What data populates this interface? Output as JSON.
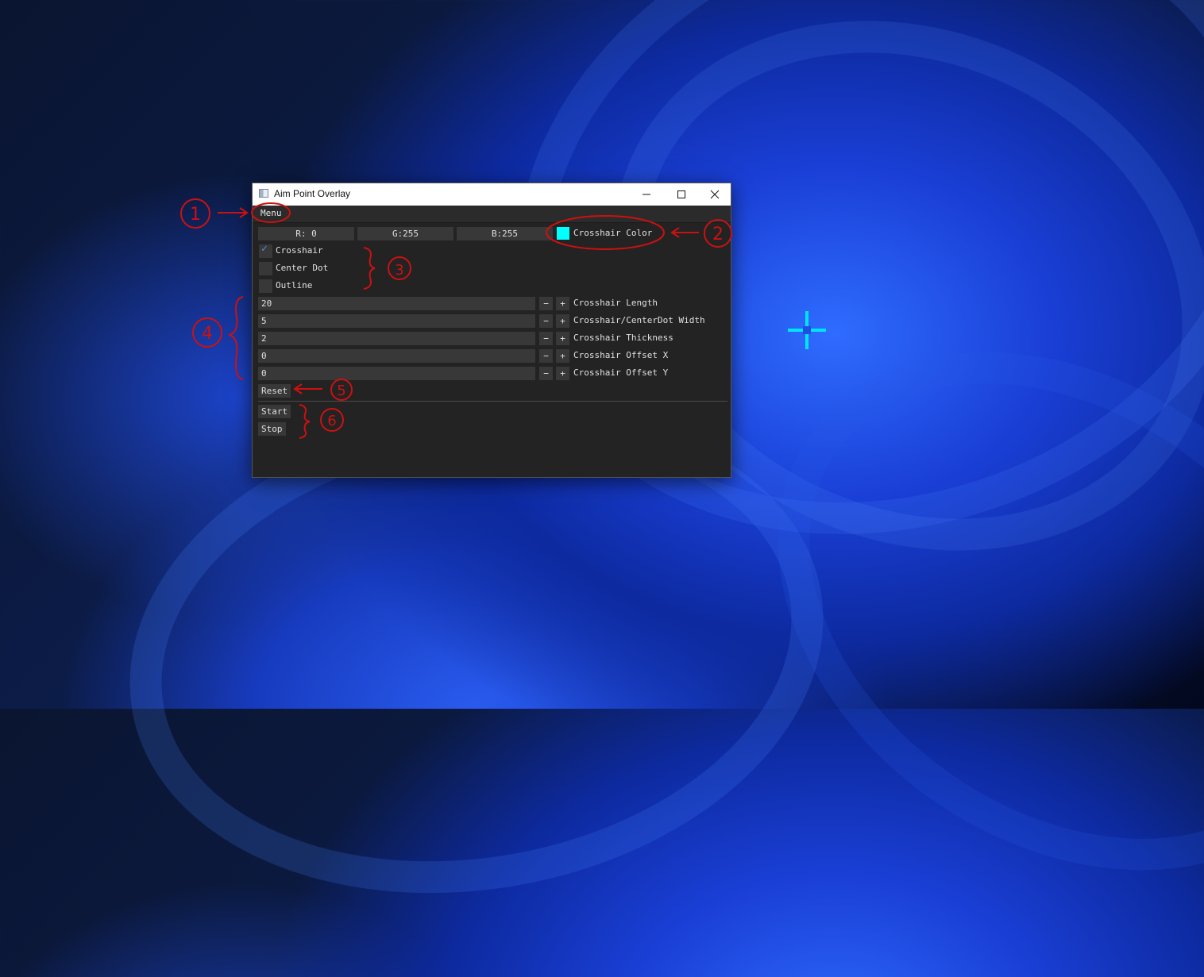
{
  "window": {
    "title": "Aim Point Overlay"
  },
  "menubar": {
    "menu_label": "Menu"
  },
  "color": {
    "r_label": "R:  0",
    "g_label": "G:255",
    "b_label": "B:255",
    "swatch_color": "#00ffff",
    "label": "Crosshair Color"
  },
  "options": [
    {
      "label": "Crosshair",
      "checked": true
    },
    {
      "label": "Center Dot",
      "checked": false
    },
    {
      "label": "Outline",
      "checked": false
    }
  ],
  "sliders": [
    {
      "value": "20",
      "label": "Crosshair Length"
    },
    {
      "value": "5",
      "label": "Crosshair/CenterDot Width"
    },
    {
      "value": "2",
      "label": "Crosshair Thickness"
    },
    {
      "value": "0",
      "label": "Crosshair Offset X"
    },
    {
      "value": "0",
      "label": "Crosshair Offset Y"
    }
  ],
  "stepper": {
    "minus": "−",
    "plus": "+"
  },
  "buttons": {
    "reset": "Reset",
    "start": "Start",
    "stop": "Stop"
  },
  "annotations": {
    "n1": "1",
    "n2": "2",
    "n3": "3",
    "n4": "4",
    "n5": "5",
    "n6": "6"
  },
  "colors": {
    "accent_crosshair": "#00e5ff",
    "annotation_red": "#cc1111"
  }
}
